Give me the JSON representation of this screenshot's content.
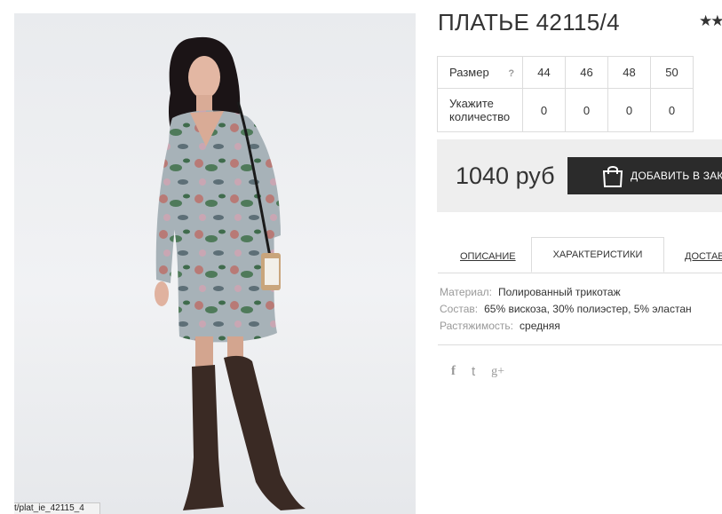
{
  "product": {
    "title": "ПЛАТЬЕ 42115/4",
    "rating_stars": "★★"
  },
  "sizes": {
    "header_label": "Размер",
    "help_icon": "?",
    "qty_label_line1": "Укажите",
    "qty_label_line2": "количество",
    "columns": [
      {
        "size": "44",
        "qty": "0"
      },
      {
        "size": "46",
        "qty": "0"
      },
      {
        "size": "48",
        "qty": "0"
      },
      {
        "size": "50",
        "qty": "0"
      }
    ]
  },
  "purchase": {
    "price": "1040 руб",
    "add_to_cart": "ДОБАВИТЬ В ЗАКА"
  },
  "tabs": {
    "description": "ОПИСАНИЕ",
    "characteristics": "ХАРАКТЕРИСТИКИ",
    "shipping": "ДОСТАВ"
  },
  "specs": [
    {
      "key": "Материал:",
      "value": "Полированный трикотаж"
    },
    {
      "key": "Состав:",
      "value": "65% вискоза, 30% полиэстер, 5% эластан"
    },
    {
      "key": "Растяжимость:",
      "value": "средняя"
    }
  ],
  "social": {
    "facebook": "f",
    "twitter": "t",
    "googleplus": "g+"
  },
  "status_bar": {
    "url": "t/plat_ie_42115_4"
  },
  "colors": {
    "button_bg": "#2b2b2b",
    "buy_box_bg": "#eeeeee",
    "border": "#dcdcdc"
  }
}
